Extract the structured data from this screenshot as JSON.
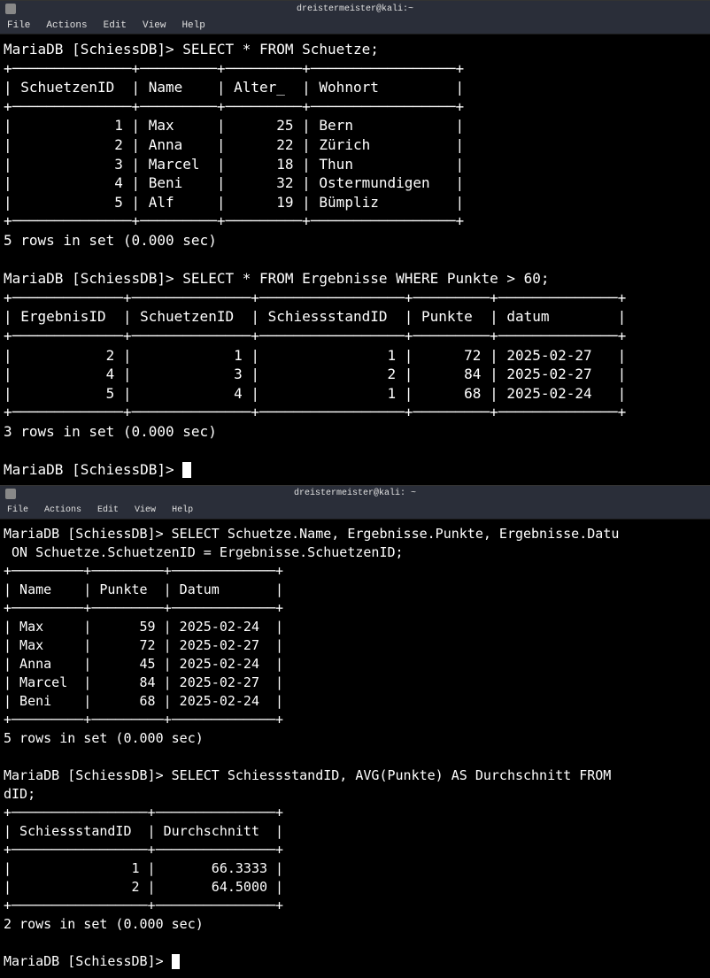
{
  "window1": {
    "title": "dreistermeister@kali:~",
    "menu": [
      "File",
      "Actions",
      "Edit",
      "View",
      "Help"
    ],
    "prompt": "MariaDB [SchiessDB]>",
    "query1": "SELECT * FROM Schuetze;",
    "table1": {
      "headers": [
        "SchuetzenID",
        "Name",
        "Alter_",
        "Wohnort"
      ],
      "rows": [
        [
          "1",
          "Max",
          "25",
          "Bern"
        ],
        [
          "2",
          "Anna",
          "22",
          "Zürich"
        ],
        [
          "3",
          "Marcel",
          "18",
          "Thun"
        ],
        [
          "4",
          "Beni",
          "32",
          "Ostermundigen"
        ],
        [
          "5",
          "Alf",
          "19",
          "Bümpliz"
        ]
      ],
      "footer": "5 rows in set (0.000 sec)"
    },
    "query2": "SELECT * FROM Ergebnisse WHERE Punkte > 60;",
    "table2": {
      "headers": [
        "ErgebnisID",
        "SchuetzenID",
        "SchiessstandID",
        "Punkte",
        "datum"
      ],
      "rows": [
        [
          "2",
          "1",
          "1",
          "72",
          "2025-02-27"
        ],
        [
          "4",
          "3",
          "2",
          "84",
          "2025-02-27"
        ],
        [
          "5",
          "4",
          "1",
          "68",
          "2025-02-24"
        ]
      ],
      "footer": "3 rows in set (0.000 sec)"
    }
  },
  "window2": {
    "title": "dreistermeister@kali: ~",
    "menu": [
      "File",
      "Actions",
      "Edit",
      "View",
      "Help"
    ],
    "prompt": "MariaDB [SchiessDB]>",
    "query1a": "SELECT Schuetze.Name, Ergebnisse.Punkte, Ergebnisse.Datu",
    "query1b": " ON Schuetze.SchuetzenID = Ergebnisse.SchuetzenID;",
    "table1": {
      "headers": [
        "Name",
        "Punkte",
        "Datum"
      ],
      "rows": [
        [
          "Max",
          "59",
          "2025-02-24"
        ],
        [
          "Max",
          "72",
          "2025-02-27"
        ],
        [
          "Anna",
          "45",
          "2025-02-24"
        ],
        [
          "Marcel",
          "84",
          "2025-02-27"
        ],
        [
          "Beni",
          "68",
          "2025-02-24"
        ]
      ],
      "footer": "5 rows in set (0.000 sec)"
    },
    "query2a": "SELECT SchiessstandID, AVG(Punkte) AS Durchschnitt FROM ",
    "query2b": "dID;",
    "table2": {
      "headers": [
        "SchiessstandID",
        "Durchschnitt"
      ],
      "rows": [
        [
          "1",
          "66.3333"
        ],
        [
          "2",
          "64.5000"
        ]
      ],
      "footer": "2 rows in set (0.000 sec)"
    }
  }
}
